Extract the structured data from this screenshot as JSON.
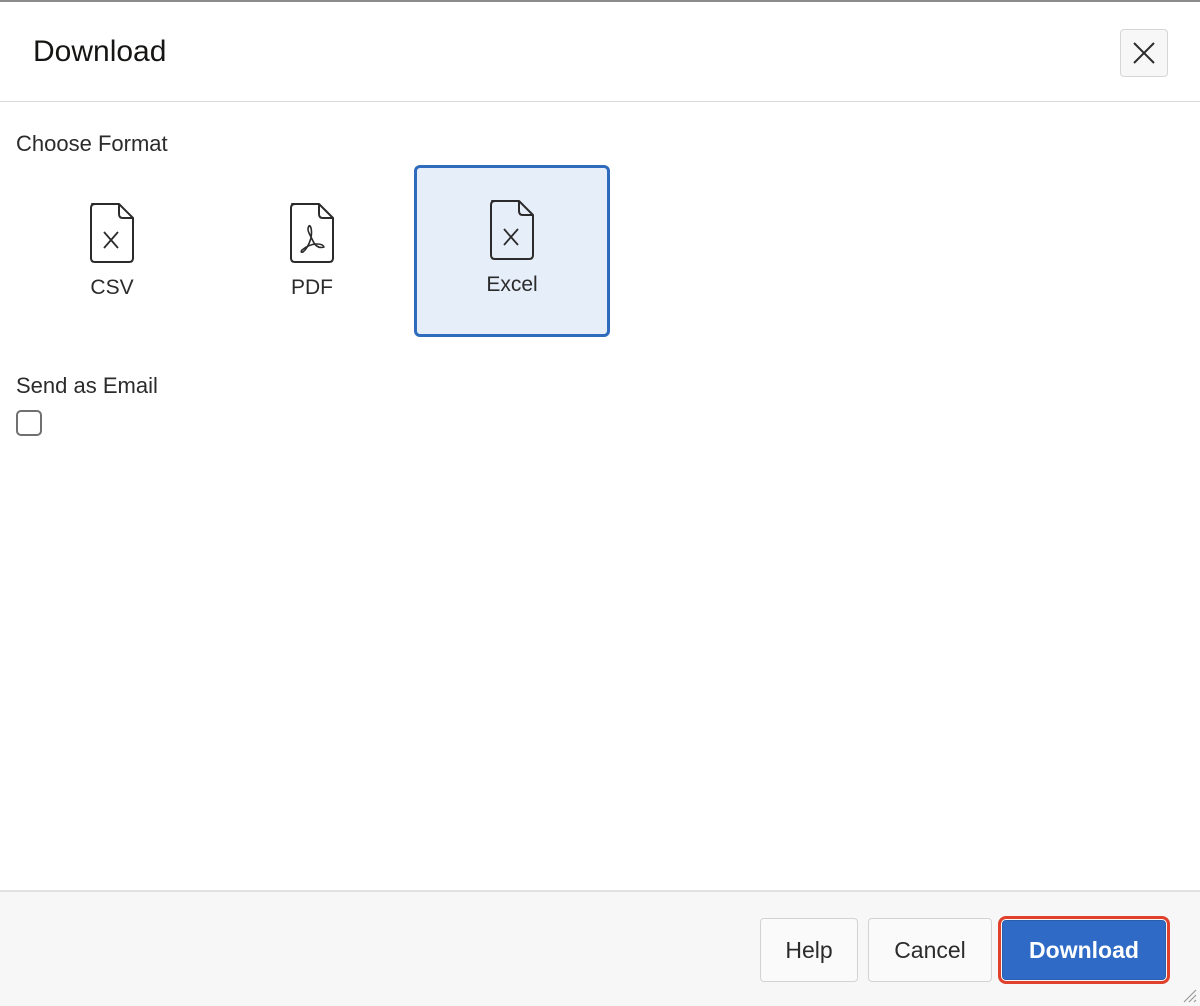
{
  "dialog": {
    "title": "Download",
    "close_icon": "close-icon"
  },
  "format_section": {
    "label": "Choose Format",
    "selected": "Excel",
    "options": [
      {
        "label": "CSV",
        "icon": "csv-file-icon"
      },
      {
        "label": "PDF",
        "icon": "pdf-file-icon"
      },
      {
        "label": "Excel",
        "icon": "excel-file-icon"
      }
    ]
  },
  "email_section": {
    "label": "Send as Email",
    "checked": false
  },
  "footer": {
    "help_label": "Help",
    "cancel_label": "Cancel",
    "download_label": "Download"
  },
  "colors": {
    "accent": "#2f6bc6",
    "selected_background": "#e6eef9",
    "highlight_outline": "#e0412c"
  }
}
